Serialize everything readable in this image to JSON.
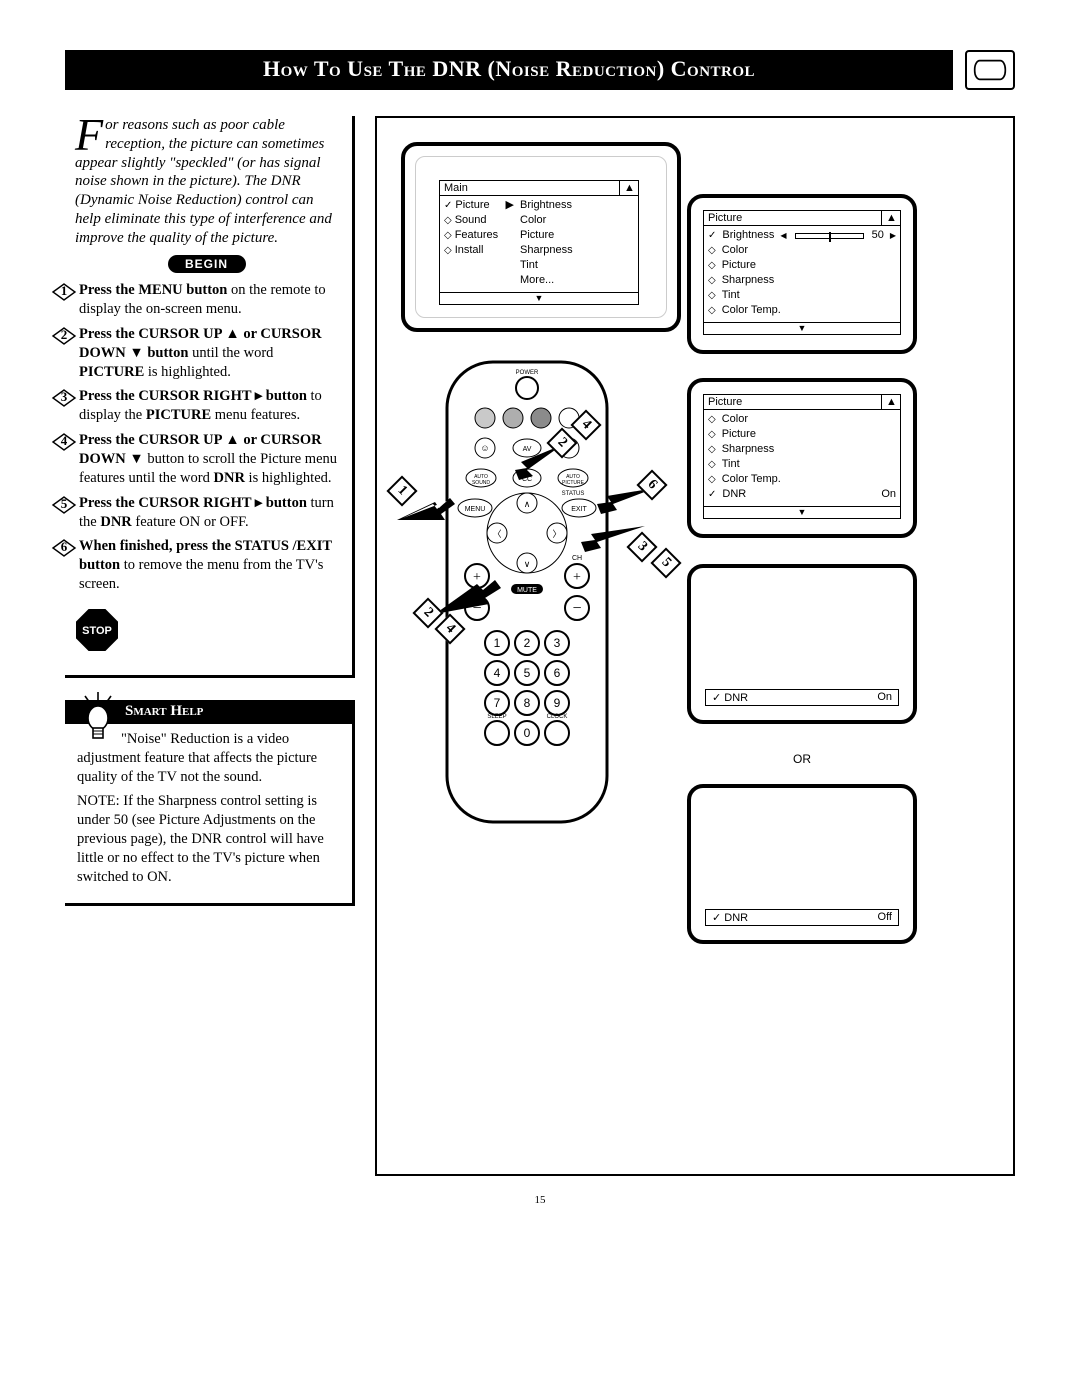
{
  "title": "How To Use The DNR (Noise Reduction) Control",
  "intro_dropcap": "F",
  "intro": "or reasons such as poor cable reception, the picture can sometimes appear slightly \"speckled\" (or has signal noise shown in the picture). The DNR (Dynamic Noise Reduction) control can help eliminate this type of interference and improve the quality of the picture.",
  "begin": "BEGIN",
  "steps": [
    {
      "n": "1",
      "html": "<b>Press the MENU button</b> on the remote to display the on-screen menu."
    },
    {
      "n": "2",
      "html": "<b>Press the CURSOR UP ▲ or CURSOR DOWN ▼ button</b> until the word <b>PICTURE</b> is highlighted."
    },
    {
      "n": "3",
      "html": "<b>Press the CURSOR RIGHT ▸ button</b> to display the <b>PICTURE</b> menu features."
    },
    {
      "n": "4",
      "html": "<b>Press the CURSOR UP ▲ or CURSOR DOWN ▼</b> button to scroll the Picture menu features until the word <b>DNR</b> is highlighted."
    },
    {
      "n": "5",
      "html": "<b>Press the CURSOR RIGHT ▸ button</b> turn the <b>DNR</b> feature ON or OFF."
    },
    {
      "n": "6",
      "html": "<b>When finished, press the STATUS /EXIT button</b> to remove the menu from the TV's screen."
    }
  ],
  "stop": "STOP",
  "smarthelp": {
    "heading": "Smart Help",
    "p1": "\"Noise\" Reduction is a video adjustment feature that affects the picture quality of the TV not the sound.",
    "p2": "NOTE: If the Sharpness control setting is under 50 (see Picture Adjustments on the previous page), the DNR control will have little or no effect to the TV's picture when switched to ON."
  },
  "osd_main": {
    "title": "Main",
    "left": [
      [
        "✓",
        "Picture",
        "▶"
      ],
      [
        "◇",
        "Sound",
        ""
      ],
      [
        "◇",
        "Features",
        ""
      ],
      [
        "◇",
        "Install",
        ""
      ]
    ],
    "right": [
      "Brightness",
      "Color",
      "Picture",
      "Sharpness",
      "Tint",
      "More..."
    ]
  },
  "osd_picture1": {
    "title": "Picture",
    "rows": [
      [
        "✓",
        "Brightness",
        "slider",
        "50"
      ],
      [
        "◇",
        "Color"
      ],
      [
        "◇",
        "Picture"
      ],
      [
        "◇",
        "Sharpness"
      ],
      [
        "◇",
        "Tint"
      ],
      [
        "◇",
        "Color Temp."
      ]
    ]
  },
  "osd_picture2": {
    "title": "Picture",
    "rows": [
      [
        "◇",
        "Color"
      ],
      [
        "◇",
        "Picture"
      ],
      [
        "◇",
        "Sharpness"
      ],
      [
        "◇",
        "Tint"
      ],
      [
        "◇",
        "Color Temp."
      ],
      [
        "✓",
        "DNR",
        "",
        "On"
      ]
    ]
  },
  "dnr_on": {
    "label": "DNR",
    "value": "On",
    "mark": "✓"
  },
  "dnr_off": {
    "label": "DNR",
    "value": "Off",
    "mark": "✓"
  },
  "or": "OR",
  "remote_labels": {
    "power": "POWER",
    "av": "AV",
    "autosound": "AUTO SOUND",
    "cc": "CC",
    "autopicture": "AUTO PICTURE",
    "menu": "MENU",
    "status": "STATUS",
    "exit": "EXIT",
    "mute": "MUTE",
    "ch": "CH",
    "sleep": "SLEEP",
    "clock": "CLOCK"
  },
  "callouts": [
    "1",
    "2",
    "2",
    "3",
    "4",
    "4",
    "5",
    "6"
  ],
  "page_number": "15"
}
